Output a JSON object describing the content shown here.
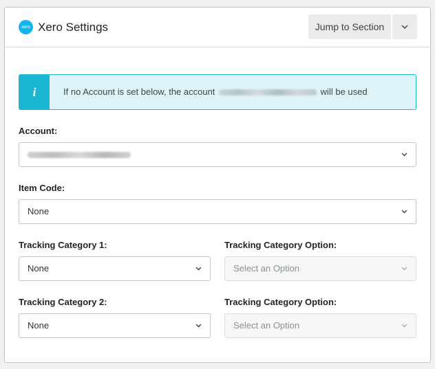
{
  "header": {
    "logo_text": "xero",
    "title": "Xero Settings",
    "jump_label": "Jump to Section",
    "jump_toggle_icon": "chevron-down-icon"
  },
  "notice": {
    "icon": "i",
    "text_before": "If no Account is set below, the account",
    "text_after": "will be used"
  },
  "fields": {
    "account": {
      "label": "Account:",
      "value": ""
    },
    "item_code": {
      "label": "Item Code:",
      "value": "None"
    },
    "tracking1": {
      "label": "Tracking Category 1:",
      "value": "None"
    },
    "tracking1_option": {
      "label": "Tracking Category Option:",
      "placeholder": "Select an Option"
    },
    "tracking2": {
      "label": "Tracking Category 2:",
      "value": "None"
    },
    "tracking2_option": {
      "label": "Tracking Category Option:",
      "placeholder": "Select an Option"
    }
  },
  "colors": {
    "xero_brand": "#13b5ea",
    "notice_accent": "#1bb7d2",
    "notice_bg": "#dff4f8"
  }
}
